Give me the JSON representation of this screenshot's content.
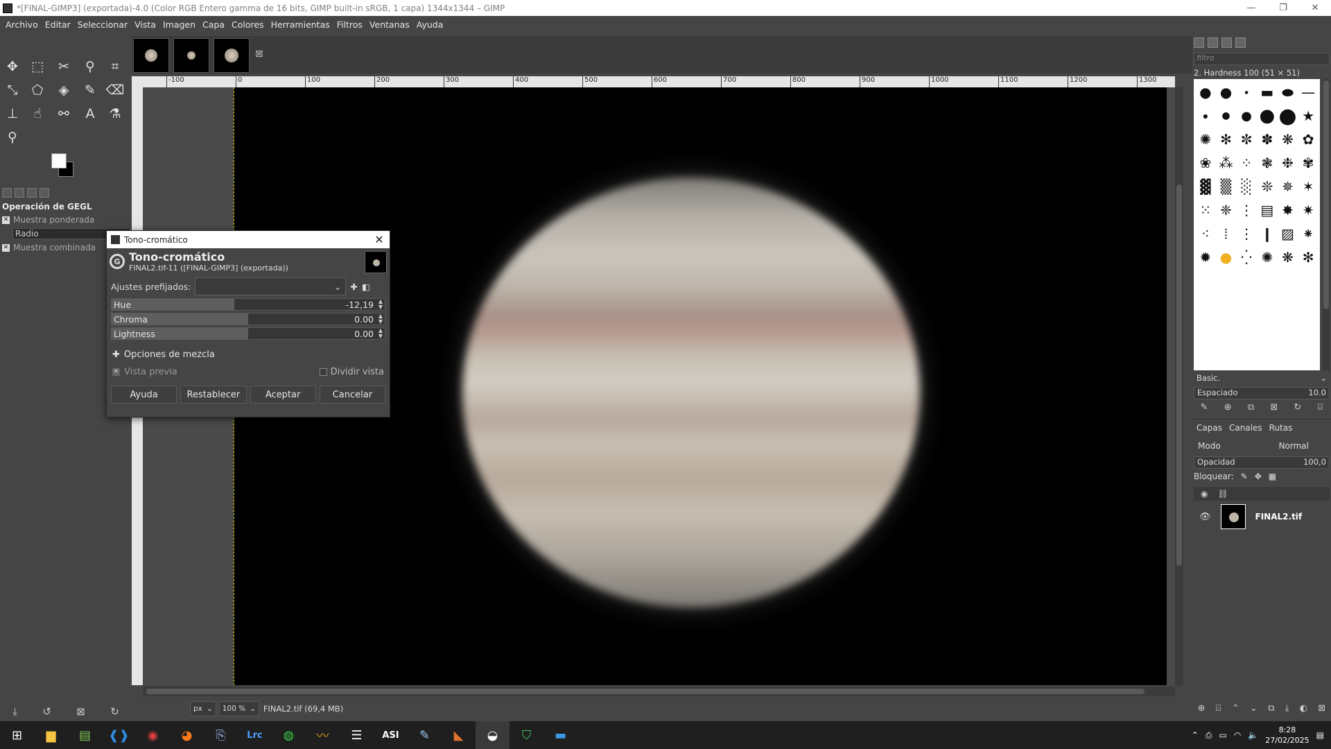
{
  "window": {
    "title": "*[FINAL-GIMP3] (exportada)-4.0 (Color RGB Entero gamma de 16 bits, GIMP built-in sRGB, 1 capa) 1344x1344 – GIMP"
  },
  "menu": [
    "Archivo",
    "Editar",
    "Seleccionar",
    "Vista",
    "Imagen",
    "Capa",
    "Colores",
    "Herramientas",
    "Filtros",
    "Ventanas",
    "Ayuda"
  ],
  "gegl_panel": {
    "title": "Operación de GEGL",
    "option1": "Muestra ponderada",
    "radio": "Radio",
    "option2": "Muestra combinada"
  },
  "ruler": {
    "h_ticks": [
      "-100",
      "0",
      "100",
      "200",
      "300",
      "400",
      "500",
      "600",
      "700",
      "800",
      "900",
      "1000",
      "1100",
      "1200",
      "1300"
    ]
  },
  "statusbar": {
    "unit": "px",
    "zoom": "100 %",
    "file": "FINAL2.tif (69,4 MB)"
  },
  "dialog": {
    "window_title": "Tono-cromático",
    "title": "Tono-cromático",
    "subtitle": "FINAL2.tif-11 ([FINAL-GIMP3] (exportada))",
    "presets_label": "Ajustes prefijados:",
    "sliders": [
      {
        "label": "Hue",
        "value": "-12,19",
        "fill": 0.45
      },
      {
        "label": "Chroma",
        "value": "0.00",
        "fill": 0.5
      },
      {
        "label": "Lightness",
        "value": "0.00",
        "fill": 0.5
      }
    ],
    "blend_options": "Opciones de mezcla",
    "preview": "Vista previa",
    "split_view": "Dividir vista",
    "buttons": {
      "help": "Ayuda",
      "reset": "Restablecer",
      "ok": "Aceptar",
      "cancel": "Cancelar"
    }
  },
  "brushes": {
    "filter_placeholder": "filtro",
    "current": "2. Hardness 100 (51 × 51)",
    "preset": "Basic.",
    "spacing_label": "Espaciado",
    "spacing_value": "10.0"
  },
  "layers": {
    "tabs": [
      "Capas",
      "Canales",
      "Rutas"
    ],
    "mode_label": "Modo",
    "mode_value": "Normal",
    "opacity_label": "Opacidad",
    "opacity_value": "100,0",
    "lock_label": "Bloquear:",
    "layer_name": "FINAL2.tif"
  },
  "taskbar": {
    "time": "8:28",
    "date": "27/02/2025"
  },
  "colors": {
    "fg": "#ffffff",
    "bg": "#000000",
    "guide": "#d4cc00"
  }
}
